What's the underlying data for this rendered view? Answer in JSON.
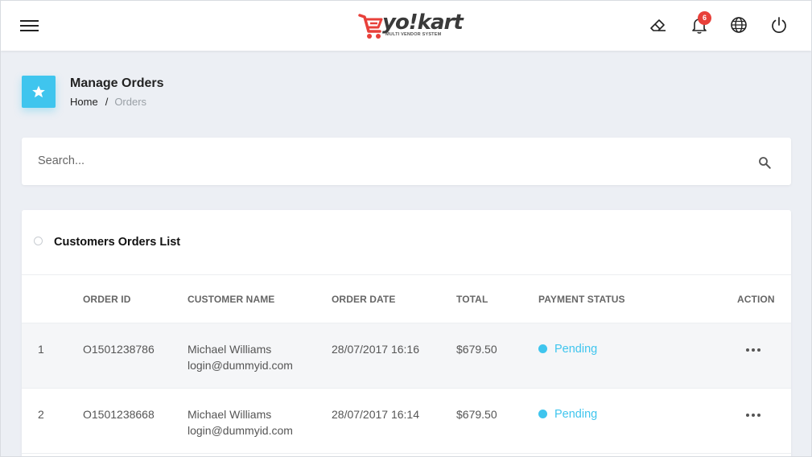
{
  "header": {
    "logo_text": "yo!kart",
    "logo_subtitle": "MULTI VENDOR SYSTEM",
    "notification_count": "6",
    "icons": [
      "menu-icon",
      "eraser-icon",
      "bell-icon",
      "globe-icon",
      "power-icon"
    ]
  },
  "page": {
    "title": "Manage Orders",
    "icon": "star-icon",
    "breadcrumb": {
      "home": "Home",
      "separator": "/",
      "current": "Orders"
    }
  },
  "search": {
    "placeholder": "Search...",
    "value": ""
  },
  "list": {
    "title": "Customers Orders List",
    "columns": [
      "ORDER ID",
      "CUSTOMER NAME",
      "ORDER DATE",
      "TOTAL",
      "PAYMENT STATUS",
      "ACTION"
    ],
    "rows": [
      {
        "index": "1",
        "order_id": "O1501238786",
        "customer_name": "Michael Williams",
        "customer_email": "login@dummyid.com",
        "order_date": "28/07/2017 16:16",
        "total": "$679.50",
        "payment_status": "Pending"
      },
      {
        "index": "2",
        "order_id": "O1501238668",
        "customer_name": "Michael Williams",
        "customer_email": "login@dummyid.com",
        "order_date": "28/07/2017 16:14",
        "total": "$679.50",
        "payment_status": "Pending"
      }
    ]
  },
  "colors": {
    "accent": "#3fc5ee",
    "brand": "#e8403a",
    "badge": "#e8403a",
    "background": "#eceff4"
  }
}
